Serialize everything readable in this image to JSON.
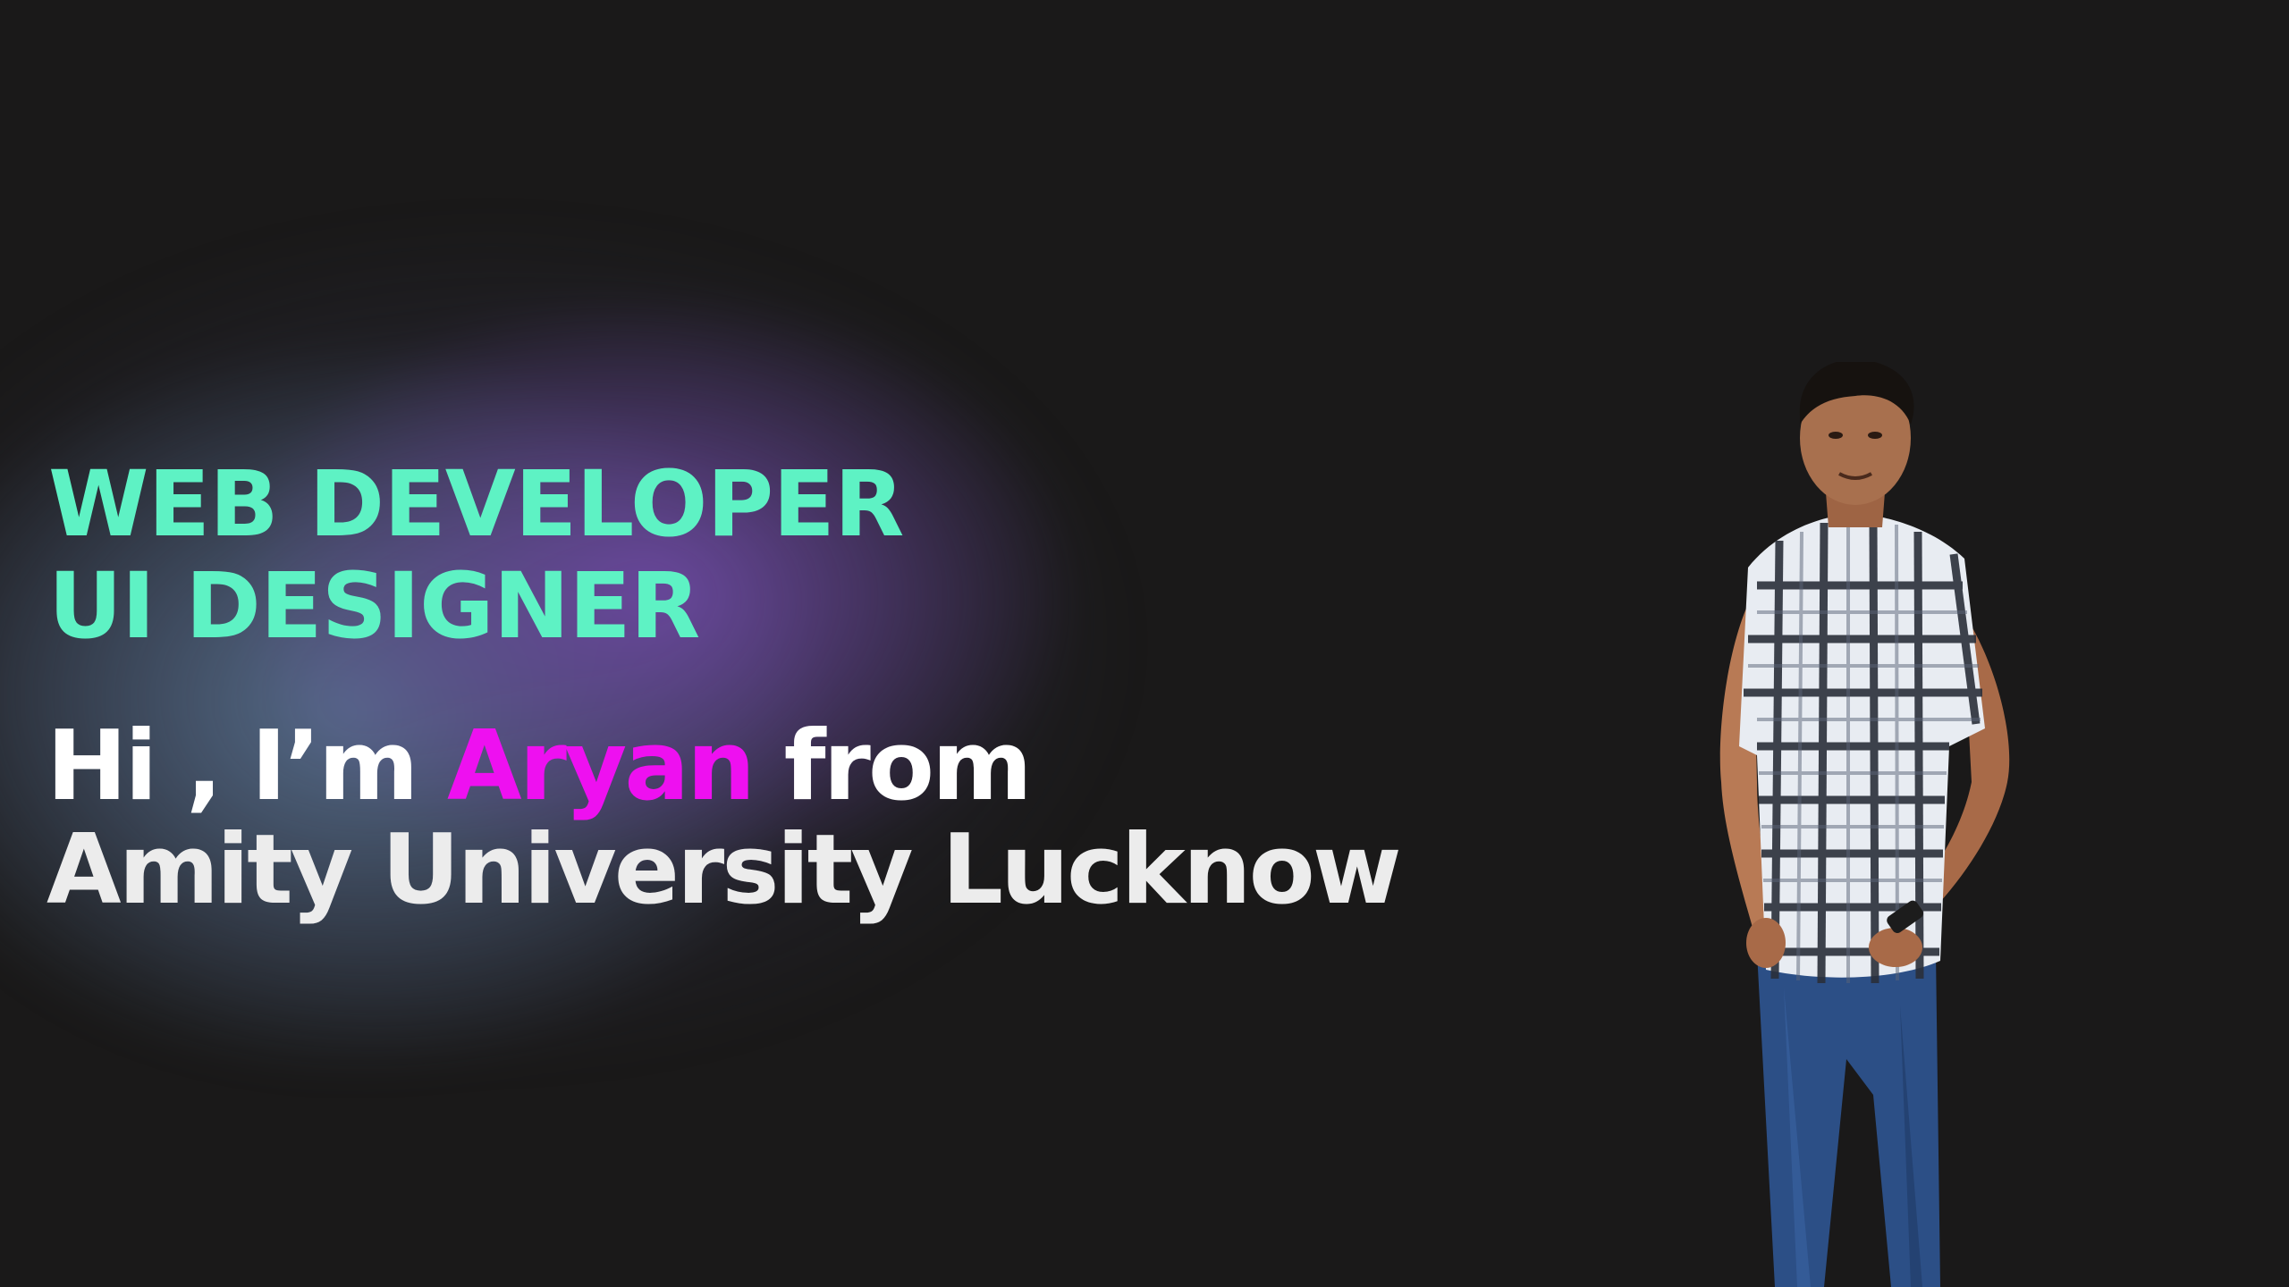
{
  "hero": {
    "role_1": "WEB DEVELOPER",
    "role_2": "UI DESIGNER",
    "greeting_prefix": "Hi , I’m",
    "name": "Aryan",
    "greeting_suffix": "from",
    "institution": "Amity University Lucknow"
  },
  "colors": {
    "background": "#1a1919",
    "role_text": "#5ef2c4",
    "name_accent": "#ee10f0",
    "body_text": "#ffffff"
  },
  "photo": {
    "icon": "person-portrait-image"
  }
}
